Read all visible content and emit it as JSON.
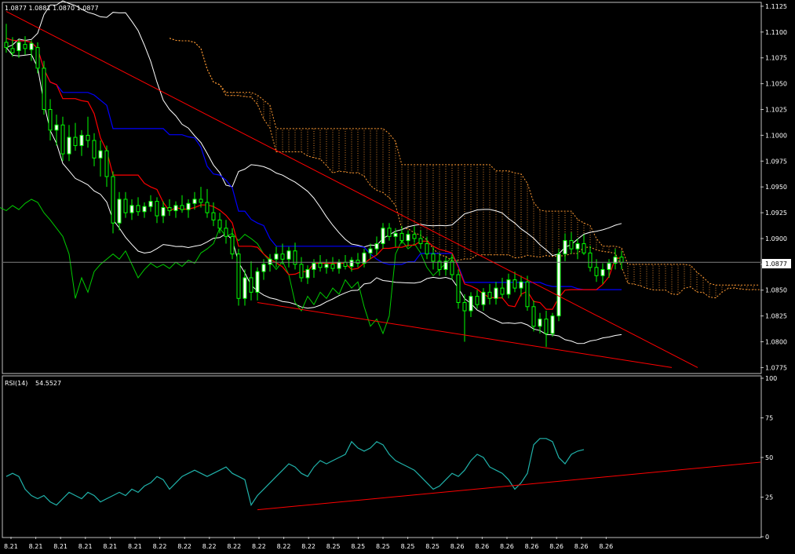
{
  "colors": {
    "background": "#000000",
    "frame": "#c0c0c0",
    "bull_candle": "#ffffff",
    "candle_wick": "#00ff00",
    "tenkan": "#ff0000",
    "kijun": "#0000ff",
    "bands": "#ffffff",
    "cloud": "#ff9a33",
    "chikou": "#00cc00",
    "rsi": "#20b2aa",
    "trendline": "#ff0000",
    "current_price": "#808080"
  },
  "price_panel": {
    "ohlc_readout": "1.0877 1.0881 1.0870 1.0877",
    "current_price_label": "1.0877"
  },
  "rsi_panel": {
    "label": "RSI(14)",
    "value_readout": "54.5527"
  },
  "chart_data": [
    {
      "type": "line",
      "panel": "price",
      "ylim": [
        1.077,
        1.1128
      ],
      "y_ticks": [
        "1.1125",
        "1.1100",
        "1.1075",
        "1.1050",
        "1.1025",
        "1.1000",
        "1.0975",
        "1.0950",
        "1.0925",
        "1.0900",
        "1.0875",
        "1.0850",
        "1.0825",
        "1.0800",
        "1.0775"
      ],
      "x_tick_labels": [
        "8.21",
        "8.21",
        "8.21",
        "8.21",
        "8.21",
        "8.21",
        "8.22",
        "8.22",
        "8.22",
        "8.22",
        "8.22",
        "8.22",
        "8.22",
        "8.25",
        "8.25",
        "8.25",
        "8.25",
        "8.25",
        "8.26",
        "8.26",
        "8.26",
        "8.26",
        "8.26",
        "8.26",
        "8.26"
      ],
      "current_price": 1.0877,
      "candles": [
        {
          "o": 1.109,
          "h": 1.1108,
          "l": 1.108,
          "c": 1.1085
        },
        {
          "o": 1.1084,
          "h": 1.1095,
          "l": 1.1076,
          "c": 1.108
        },
        {
          "o": 1.1082,
          "h": 1.1093,
          "l": 1.1075,
          "c": 1.109
        },
        {
          "o": 1.1088,
          "h": 1.1096,
          "l": 1.1078,
          "c": 1.1084
        },
        {
          "o": 1.1083,
          "h": 1.1092,
          "l": 1.1072,
          "c": 1.1089
        },
        {
          "o": 1.1085,
          "h": 1.109,
          "l": 1.106,
          "c": 1.1065
        },
        {
          "o": 1.1065,
          "h": 1.1072,
          "l": 1.102,
          "c": 1.1025
        },
        {
          "o": 1.1025,
          "h": 1.1035,
          "l": 1.0995,
          "c": 1.1005
        },
        {
          "o": 1.1005,
          "h": 1.102,
          "l": 1.099,
          "c": 1.101
        },
        {
          "o": 1.101,
          "h": 1.1018,
          "l": 1.0975,
          "c": 1.0982
        },
        {
          "o": 1.0982,
          "h": 1.101,
          "l": 1.0975,
          "c": 1.0998
        },
        {
          "o": 1.0998,
          "h": 1.1012,
          "l": 1.0985,
          "c": 1.099
        },
        {
          "o": 1.099,
          "h": 1.1005,
          "l": 1.098,
          "c": 1.1
        },
        {
          "o": 1.1,
          "h": 1.1018,
          "l": 1.0988,
          "c": 1.0995
        },
        {
          "o": 1.0995,
          "h": 1.1002,
          "l": 1.097,
          "c": 1.0978
        },
        {
          "o": 1.0978,
          "h": 1.0995,
          "l": 1.096,
          "c": 1.0985
        },
        {
          "o": 1.0985,
          "h": 1.099,
          "l": 1.095,
          "c": 1.096
        },
        {
          "o": 1.096,
          "h": 1.0965,
          "l": 1.0905,
          "c": 1.0915
        },
        {
          "o": 1.0915,
          "h": 1.0945,
          "l": 1.0908,
          "c": 1.0938
        },
        {
          "o": 1.0938,
          "h": 1.0945,
          "l": 1.092,
          "c": 1.0925
        },
        {
          "o": 1.0925,
          "h": 1.0938,
          "l": 1.0918,
          "c": 1.0932
        },
        {
          "o": 1.0932,
          "h": 1.094,
          "l": 1.0922,
          "c": 1.0926
        },
        {
          "o": 1.0926,
          "h": 1.0935,
          "l": 1.092,
          "c": 1.0931
        },
        {
          "o": 1.0931,
          "h": 1.0942,
          "l": 1.0926,
          "c": 1.0936
        },
        {
          "o": 1.0936,
          "h": 1.094,
          "l": 1.0915,
          "c": 1.0922
        },
        {
          "o": 1.0922,
          "h": 1.0936,
          "l": 1.0915,
          "c": 1.093
        },
        {
          "o": 1.093,
          "h": 1.0938,
          "l": 1.0922,
          "c": 1.0927
        },
        {
          "o": 1.0927,
          "h": 1.0936,
          "l": 1.092,
          "c": 1.0932
        },
        {
          "o": 1.0932,
          "h": 1.0942,
          "l": 1.0925,
          "c": 1.0928
        },
        {
          "o": 1.0928,
          "h": 1.0938,
          "l": 1.092,
          "c": 1.0934
        },
        {
          "o": 1.0934,
          "h": 1.0945,
          "l": 1.0928,
          "c": 1.0938
        },
        {
          "o": 1.0938,
          "h": 1.095,
          "l": 1.093,
          "c": 1.0935
        },
        {
          "o": 1.0935,
          "h": 1.0948,
          "l": 1.092,
          "c": 1.0925
        },
        {
          "o": 1.0925,
          "h": 1.0935,
          "l": 1.0912,
          "c": 1.0918
        },
        {
          "o": 1.0918,
          "h": 1.0925,
          "l": 1.0905,
          "c": 1.091
        },
        {
          "o": 1.091,
          "h": 1.0918,
          "l": 1.0895,
          "c": 1.0902
        },
        {
          "o": 1.0902,
          "h": 1.091,
          "l": 1.088,
          "c": 1.0885
        },
        {
          "o": 1.0885,
          "h": 1.089,
          "l": 1.0835,
          "c": 1.0842
        },
        {
          "o": 1.0842,
          "h": 1.087,
          "l": 1.0835,
          "c": 1.0862
        },
        {
          "o": 1.0862,
          "h": 1.0878,
          "l": 1.084,
          "c": 1.0848
        },
        {
          "o": 1.0848,
          "h": 1.0872,
          "l": 1.084,
          "c": 1.0868
        },
        {
          "o": 1.0868,
          "h": 1.088,
          "l": 1.086,
          "c": 1.0875
        },
        {
          "o": 1.0875,
          "h": 1.0885,
          "l": 1.0868,
          "c": 1.088
        },
        {
          "o": 1.088,
          "h": 1.0892,
          "l": 1.0872,
          "c": 1.0885
        },
        {
          "o": 1.0885,
          "h": 1.0895,
          "l": 1.0875,
          "c": 1.088
        },
        {
          "o": 1.088,
          "h": 1.0892,
          "l": 1.0872,
          "c": 1.0888
        },
        {
          "o": 1.0888,
          "h": 1.0896,
          "l": 1.087,
          "c": 1.0875
        },
        {
          "o": 1.0875,
          "h": 1.0882,
          "l": 1.0858,
          "c": 1.0862
        },
        {
          "o": 1.0862,
          "h": 1.0874,
          "l": 1.0856,
          "c": 1.087
        },
        {
          "o": 1.087,
          "h": 1.088,
          "l": 1.0862,
          "c": 1.0876
        },
        {
          "o": 1.0876,
          "h": 1.0884,
          "l": 1.0868,
          "c": 1.0872
        },
        {
          "o": 1.0872,
          "h": 1.088,
          "l": 1.0866,
          "c": 1.0875
        },
        {
          "o": 1.0875,
          "h": 1.0882,
          "l": 1.0868,
          "c": 1.0871
        },
        {
          "o": 1.0871,
          "h": 1.088,
          "l": 1.0866,
          "c": 1.0877
        },
        {
          "o": 1.0877,
          "h": 1.0884,
          "l": 1.087,
          "c": 1.0873
        },
        {
          "o": 1.0873,
          "h": 1.0882,
          "l": 1.0868,
          "c": 1.0879
        },
        {
          "o": 1.0879,
          "h": 1.0886,
          "l": 1.0872,
          "c": 1.0876
        },
        {
          "o": 1.0876,
          "h": 1.089,
          "l": 1.0872,
          "c": 1.0886
        },
        {
          "o": 1.0886,
          "h": 1.0895,
          "l": 1.088,
          "c": 1.089
        },
        {
          "o": 1.089,
          "h": 1.0902,
          "l": 1.0884,
          "c": 1.0895
        },
        {
          "o": 1.0895,
          "h": 1.0915,
          "l": 1.089,
          "c": 1.091
        },
        {
          "o": 1.091,
          "h": 1.0915,
          "l": 1.0898,
          "c": 1.0902
        },
        {
          "o": 1.0902,
          "h": 1.091,
          "l": 1.0892,
          "c": 1.0905
        },
        {
          "o": 1.0905,
          "h": 1.0912,
          "l": 1.0895,
          "c": 1.0898
        },
        {
          "o": 1.0898,
          "h": 1.0908,
          "l": 1.0892,
          "c": 1.0904
        },
        {
          "o": 1.0904,
          "h": 1.0912,
          "l": 1.0896,
          "c": 1.09
        },
        {
          "o": 1.09,
          "h": 1.0908,
          "l": 1.089,
          "c": 1.0895
        },
        {
          "o": 1.0895,
          "h": 1.0902,
          "l": 1.088,
          "c": 1.0885
        },
        {
          "o": 1.0885,
          "h": 1.0892,
          "l": 1.087,
          "c": 1.0878
        },
        {
          "o": 1.0878,
          "h": 1.0886,
          "l": 1.0864,
          "c": 1.087
        },
        {
          "o": 1.087,
          "h": 1.0882,
          "l": 1.0864,
          "c": 1.0878
        },
        {
          "o": 1.0878,
          "h": 1.0885,
          "l": 1.086,
          "c": 1.0865
        },
        {
          "o": 1.0865,
          "h": 1.087,
          "l": 1.0832,
          "c": 1.0838
        },
        {
          "o": 1.0838,
          "h": 1.0846,
          "l": 1.08,
          "c": 1.083
        },
        {
          "o": 1.083,
          "h": 1.0848,
          "l": 1.0824,
          "c": 1.0844
        },
        {
          "o": 1.0844,
          "h": 1.085,
          "l": 1.0832,
          "c": 1.0836
        },
        {
          "o": 1.0836,
          "h": 1.0852,
          "l": 1.083,
          "c": 1.0848
        },
        {
          "o": 1.0848,
          "h": 1.0856,
          "l": 1.0836,
          "c": 1.0842
        },
        {
          "o": 1.0842,
          "h": 1.0858,
          "l": 1.0836,
          "c": 1.0852
        },
        {
          "o": 1.0852,
          "h": 1.0862,
          "l": 1.0842,
          "c": 1.0846
        },
        {
          "o": 1.0846,
          "h": 1.0866,
          "l": 1.0842,
          "c": 1.086
        },
        {
          "o": 1.086,
          "h": 1.0868,
          "l": 1.0848,
          "c": 1.0852
        },
        {
          "o": 1.0852,
          "h": 1.0864,
          "l": 1.0844,
          "c": 1.0858
        },
        {
          "o": 1.0858,
          "h": 1.0864,
          "l": 1.083,
          "c": 1.0834
        },
        {
          "o": 1.0834,
          "h": 1.084,
          "l": 1.081,
          "c": 1.0815
        },
        {
          "o": 1.0815,
          "h": 1.0828,
          "l": 1.0808,
          "c": 1.0822
        },
        {
          "o": 1.0822,
          "h": 1.083,
          "l": 1.0795,
          "c": 1.0808
        },
        {
          "o": 1.0808,
          "h": 1.0828,
          "l": 1.0805,
          "c": 1.0825
        },
        {
          "o": 1.0825,
          "h": 1.089,
          "l": 1.082,
          "c": 1.0885
        },
        {
          "o": 1.0885,
          "h": 1.0905,
          "l": 1.0878,
          "c": 1.0898
        },
        {
          "o": 1.0898,
          "h": 1.0906,
          "l": 1.0885,
          "c": 1.089
        },
        {
          "o": 1.089,
          "h": 1.09,
          "l": 1.088,
          "c": 1.0895
        },
        {
          "o": 1.0895,
          "h": 1.0904,
          "l": 1.0884,
          "c": 1.0886
        },
        {
          "o": 1.0886,
          "h": 1.0893,
          "l": 1.0868,
          "c": 1.0872
        },
        {
          "o": 1.0872,
          "h": 1.088,
          "l": 1.0858,
          "c": 1.0864
        },
        {
          "o": 1.0864,
          "h": 1.0876,
          "l": 1.0856,
          "c": 1.087
        },
        {
          "o": 1.087,
          "h": 1.088,
          "l": 1.0862,
          "c": 1.0876
        },
        {
          "o": 1.0876,
          "h": 1.089,
          "l": 1.087,
          "c": 1.0882
        },
        {
          "o": 1.0882,
          "h": 1.0888,
          "l": 1.087,
          "c": 1.0877
        }
      ],
      "trendlines": [
        {
          "from": [
            0,
            1.112
          ],
          "to": [
            124,
            1.0775
          ]
        },
        {
          "from": [
            40,
            1.0838
          ],
          "to": [
            106,
            1.0775
          ]
        }
      ]
    },
    {
      "type": "line",
      "panel": "rsi",
      "ylim": [
        0,
        100
      ],
      "y_ticks": [
        "100",
        "75",
        "50",
        "25",
        "0"
      ],
      "name": "RSI(14)",
      "values": [
        38,
        40,
        38,
        30,
        26,
        24,
        26,
        22,
        20,
        24,
        28,
        26,
        24,
        28,
        26,
        22,
        24,
        26,
        28,
        26,
        30,
        28,
        32,
        34,
        38,
        36,
        30,
        34,
        38,
        40,
        42,
        40,
        38,
        40,
        42,
        44,
        40,
        38,
        36,
        20,
        26,
        30,
        34,
        38,
        42,
        46,
        44,
        40,
        38,
        44,
        48,
        46,
        48,
        50,
        52,
        60,
        56,
        54,
        56,
        60,
        58,
        52,
        48,
        46,
        44,
        42,
        38,
        34,
        30,
        32,
        36,
        40,
        38,
        42,
        48,
        52,
        50,
        44,
        42,
        40,
        36,
        30,
        34,
        40,
        58,
        62,
        62,
        60,
        50,
        46,
        52,
        54,
        55
      ],
      "trendlines": [
        {
          "from": [
            40,
            17
          ],
          "to": [
            124,
            47
          ]
        }
      ]
    }
  ]
}
